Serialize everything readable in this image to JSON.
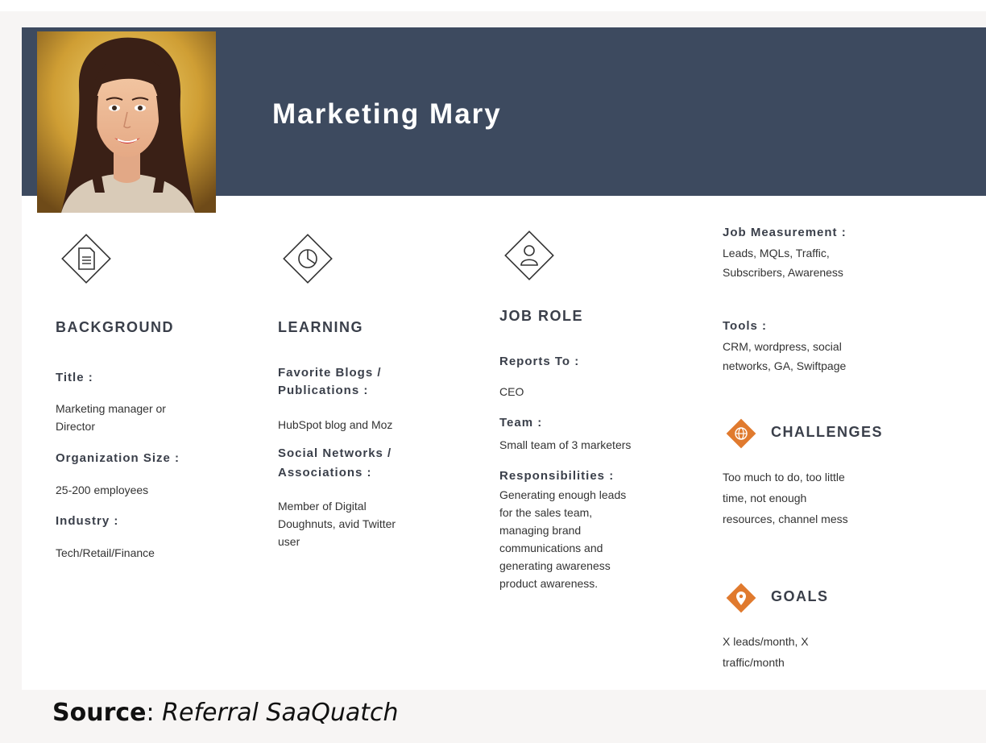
{
  "persona": {
    "name": "Marketing Mary"
  },
  "background": {
    "heading": "BACKGROUND",
    "title_label": "Title :",
    "title_value_1": "Marketing manager or",
    "title_value_2": "Director",
    "org_label": "Organization Size :",
    "org_value": "25-200 employees",
    "industry_label": "Industry :",
    "industry_value": "Tech/Retail/Finance"
  },
  "learning": {
    "heading": "LEARNING",
    "blogs_label_1": "Favorite Blogs /",
    "blogs_label_2": "Publications :",
    "blogs_value": "HubSpot blog and Moz",
    "social_label_1": "Social Networks /",
    "social_label_2": "Associations  :",
    "social_value_1": "Member of Digital",
    "social_value_2": "Doughnuts, avid Twitter",
    "social_value_3": "user"
  },
  "job_role": {
    "heading": "JOB ROLE",
    "reports_label": "Reports To :",
    "reports_value": "CEO",
    "team_label": "Team :",
    "team_value": "Small team of 3 marketers",
    "resp_label": "Responsibilities :",
    "resp_value_1": "Generating enough leads",
    "resp_value_2": "for the sales team,",
    "resp_value_3": "managing brand",
    "resp_value_4": "communications and",
    "resp_value_5": "generating awareness",
    "resp_value_6": "product awareness."
  },
  "measure": {
    "label": "Job Measurement :",
    "value_1": "Leads, MQLs, Traffic,",
    "value_2": "Subscribers, Awareness",
    "tools_label": "Tools :",
    "tools_value_1": "CRM, wordpress, social",
    "tools_value_2": "networks, GA, Swiftpage"
  },
  "challenges": {
    "heading": "CHALLENGES",
    "value_1": "Too much to do, too little",
    "value_2": "time, not enough",
    "value_3": "resources, channel mess"
  },
  "goals": {
    "heading": "GOALS",
    "value_1": "X leads/month, X",
    "value_2": "traffic/month"
  },
  "source": {
    "key": "Source",
    "sep": ": ",
    "value": "Referral SaaQuatch"
  },
  "colors": {
    "banner": "#3d4a5f",
    "accent_orange": "#e07a2e",
    "text_dark": "#3a3f4a"
  }
}
